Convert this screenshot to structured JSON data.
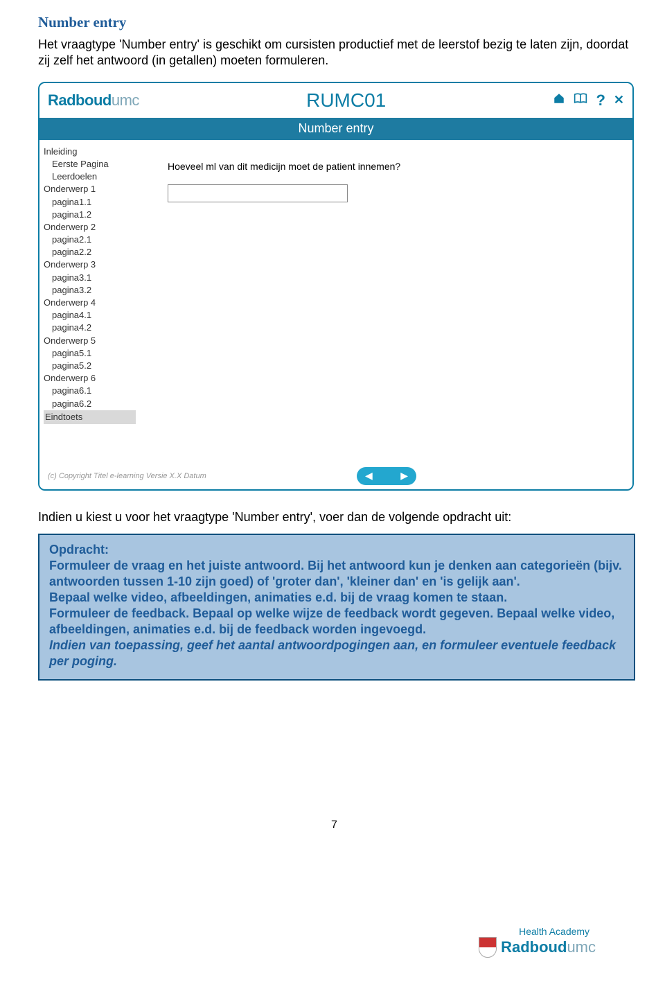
{
  "section": {
    "title": "Number entry",
    "intro": "Het vraagtype 'Number entry' is geschikt om cursisten productief met de leerstof bezig te laten zijn, doordat zij zelf het antwoord (in getallen) moeten formuleren."
  },
  "app": {
    "brand_main": "Radboud",
    "brand_sub": "umc",
    "course_code": "RUMC01",
    "icons": {
      "home": "⌂",
      "book": "▭",
      "help": "?",
      "close": "✕"
    },
    "bar_title": "Number entry",
    "sidebar": [
      {
        "label": "Inleiding",
        "lvl": 0
      },
      {
        "label": "Eerste Pagina",
        "lvl": 1
      },
      {
        "label": "Leerdoelen",
        "lvl": 1
      },
      {
        "label": "Onderwerp 1",
        "lvl": 0
      },
      {
        "label": "pagina1.1",
        "lvl": 1
      },
      {
        "label": "pagina1.2",
        "lvl": 1
      },
      {
        "label": "Onderwerp 2",
        "lvl": 0
      },
      {
        "label": "pagina2.1",
        "lvl": 1
      },
      {
        "label": "pagina2.2",
        "lvl": 1
      },
      {
        "label": "Onderwerp 3",
        "lvl": 0
      },
      {
        "label": "pagina3.1",
        "lvl": 1
      },
      {
        "label": "pagina3.2",
        "lvl": 1
      },
      {
        "label": "Onderwerp 4",
        "lvl": 0
      },
      {
        "label": "pagina4.1",
        "lvl": 1
      },
      {
        "label": "pagina4.2",
        "lvl": 1
      },
      {
        "label": "Onderwerp 5",
        "lvl": 0
      },
      {
        "label": "pagina5.1",
        "lvl": 1
      },
      {
        "label": "pagina5.2",
        "lvl": 1
      },
      {
        "label": "Onderwerp 6",
        "lvl": 0
      },
      {
        "label": "pagina6.1",
        "lvl": 1
      },
      {
        "label": "pagina6.2",
        "lvl": 1
      },
      {
        "label": "Eindtoets",
        "lvl": 0,
        "grey": true
      }
    ],
    "question": "Hoeveel ml van dit medicijn moet de patient innemen?",
    "input_value": "",
    "copyright": "(c) Copyright Titel e-learning Versie X.X Datum",
    "nav": {
      "prev": "◀",
      "next": "▶"
    }
  },
  "lead_in": "Indien u kiest u voor het vraagtype 'Number entry', voer dan de volgende opdracht uit:",
  "task": {
    "heading": "Opdracht:",
    "l1": "Formuleer de vraag en het juiste antwoord. Bij het antwoord kun je denken aan categorieën (bijv. antwoorden tussen 1-10 zijn goed) of 'groter dan', 'kleiner dan' en 'is gelijk aan'.",
    "l2": "Bepaal welke video, afbeeldingen, animaties e.d. bij de vraag komen te staan.",
    "l3": "Formuleer de feedback. Bepaal op welke wijze de feedback wordt gegeven. Bepaal welke video, afbeeldingen, animaties e.d. bij de feedback worden ingevoegd.",
    "l4": "Indien van toepassing, geef het aantal antwoordpogingen aan, en formuleer eventuele feedback per poging."
  },
  "page_number": "7",
  "footer_logo": {
    "ha": "Health Academy",
    "main": "Radboud",
    "sub": "umc"
  }
}
